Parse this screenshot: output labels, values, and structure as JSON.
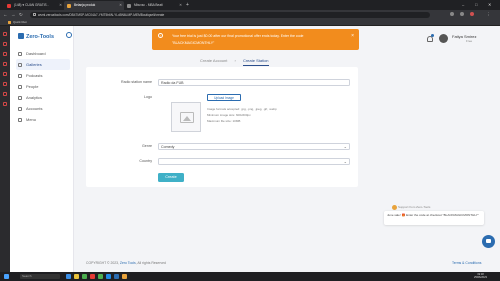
{
  "browser": {
    "tabs": [
      {
        "label": "(148) ♥ CUAN GRATIS -",
        "active": false,
        "favicon_color": "#e53935"
      },
      {
        "label": "Belanja produk",
        "active": true,
        "favicon_color": "#e8a33c"
      },
      {
        "label": "Mbuvsc - MBA Beati",
        "active": false,
        "favicon_color": "#8a8a8a"
      }
    ],
    "url": "wsml.zeroaitools.com/DB47MSP-MC04A7-YMT5h6N-YLd5N6LMP-MEMBoutiqsell/create",
    "bookmark": "Quick Run"
  },
  "app": {
    "brand": "Zero-Tools",
    "menu": [
      {
        "label": "Dashboard",
        "active": false
      },
      {
        "label": "Galleries",
        "active": true
      },
      {
        "label": "Podcasts",
        "active": false
      },
      {
        "label": "People",
        "active": false
      },
      {
        "label": "Analytics",
        "active": false
      },
      {
        "label": "Accounts",
        "active": false
      },
      {
        "label": "Menu",
        "active": false
      }
    ],
    "user": {
      "name": "Fatiya Smirez",
      "role": "Free"
    }
  },
  "alert": {
    "line1": "Your free trial is just $0.00 after our final promotional offer ends today. Enter the code",
    "line2": "\"BLACKMAGICMONTHLY\"",
    "close": "×"
  },
  "steps": {
    "step1": "Create Account",
    "separator": "›",
    "step2": "Create Station"
  },
  "form": {
    "name_label": "Radio station name",
    "name_value": "Radio da FUB",
    "logo_label": "Logo",
    "upload_label": "Upload Image",
    "hints": [
      "Image formats accepted: .jpg, .png, .jpeg, .gif, .webp",
      "Minimum image size: 600x600px",
      "Maximum file size: 10MB"
    ],
    "genre_label": "Genre",
    "genre_value": "Comedy",
    "country_label": "Country",
    "country_value": "",
    "create_label": "Create"
  },
  "footer": {
    "copyright": "COPYRIGHT © 2023,",
    "brand_link": "Zero Tools",
    "rights": ", All rights Reserved",
    "terms": "Terms & Conditions"
  },
  "chat": {
    "from": "Support from Zero-Tools",
    "message": "June sale! 🎁 Enter the code at checkout \"BLACKMAGICMONTHLY\""
  },
  "taskbar": {
    "search_placeholder": "Search",
    "time": "19:18",
    "date": "25/06/2023"
  }
}
